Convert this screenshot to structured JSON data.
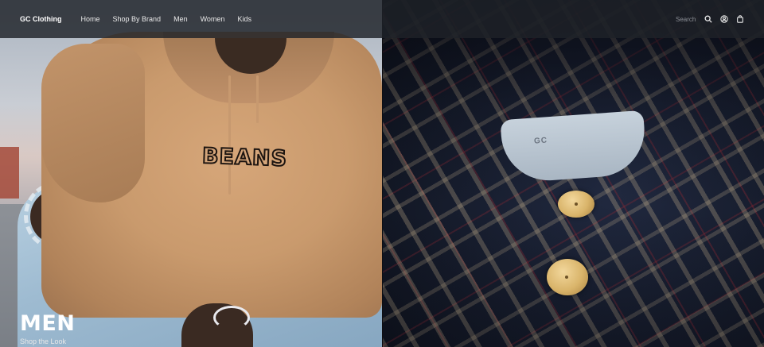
{
  "nav": {
    "brand": "GC Clothing",
    "links": [
      "Home",
      "Shop By Brand",
      "Men",
      "Women",
      "Kids"
    ],
    "search_placeholder": "Search",
    "icons": [
      "search-icon",
      "user-icon",
      "bag-icon"
    ]
  },
  "hero": {
    "left": {
      "graphic_text": "BEANS",
      "caption_title": "MEN",
      "caption_subtitle": "Shop the Look"
    },
    "right": {
      "label_text": "GC"
    }
  },
  "colors": {
    "nav_bg": "#1e2228",
    "text_primary": "#ffffff",
    "hoodie": "#c99a6d",
    "denim": "#9ebbd1",
    "plaid_base": "#1a2237"
  }
}
